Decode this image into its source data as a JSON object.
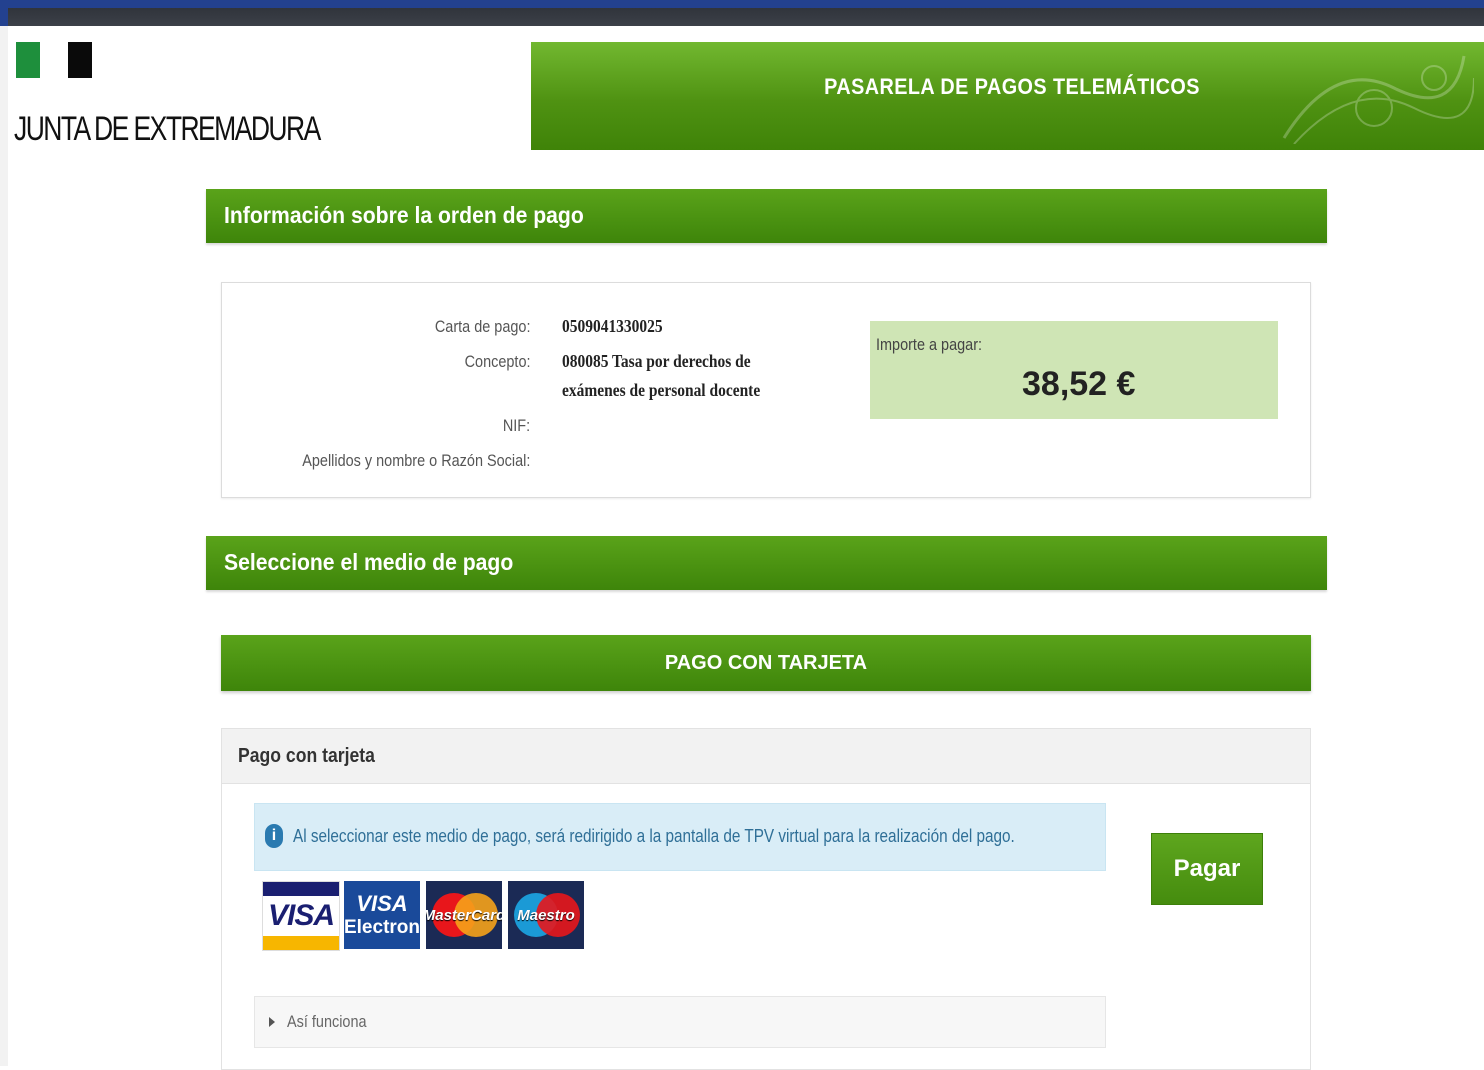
{
  "header": {
    "logo_text": "JUNTA DE EXTREMADURA",
    "title": "PASARELA DE PAGOS TELEMÁTICOS"
  },
  "section_info": {
    "title": "Información sobre la orden de pago"
  },
  "order": {
    "carta_label": "Carta de pago:",
    "carta_value": "0509041330025",
    "concepto_label": "Concepto:",
    "concepto_value": "080085 Tasa por derechos de exámenes de personal docente",
    "nif_label": "NIF:",
    "nif_value": "",
    "nombre_label": "Apellidos y nombre o Razón Social:",
    "nombre_value": "",
    "importe_label": "Importe a pagar:",
    "importe_value": "38,52 €"
  },
  "section_method": {
    "title": "Seleccione el medio de pago"
  },
  "card_method": {
    "bar_label": "PAGO CON TARJETA",
    "panel_title": "Pago con tarjeta",
    "alert_icon": "info-icon",
    "alert_text": "Al seleccionar este medio de pago, será redirigido a la pantalla de TPV virtual para la realización del pago.",
    "pay_button": "Pagar",
    "logos": [
      "VISA",
      "VISA",
      "Electron",
      "MasterCard",
      "Maestro"
    ],
    "accordion_label": "Así funciona"
  },
  "colors": {
    "brand_green": "#4f9212",
    "amount_bg": "#cfe5b5",
    "alert_bg": "#d9edf7",
    "top_accent": "#23418f"
  }
}
